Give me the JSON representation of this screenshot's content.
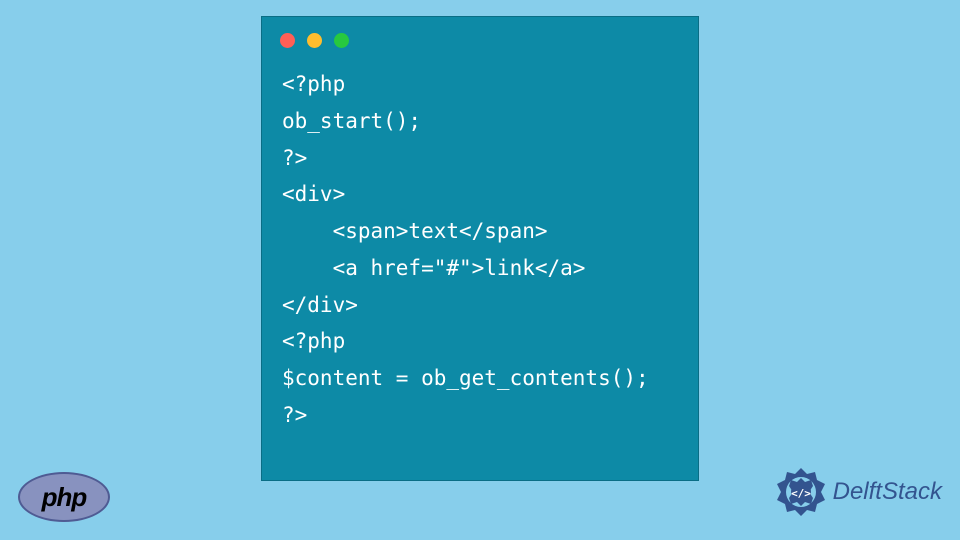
{
  "code": {
    "lines": [
      "<?php",
      "ob_start();",
      "?>",
      "<div>",
      "    <span>text</span>",
      "    <a href=\"#\">link</a>",
      "</div>",
      "<?php",
      "$content = ob_get_contents();",
      "?>"
    ]
  },
  "php_logo": {
    "text": "php"
  },
  "delft_logo": {
    "text": "DelftStack"
  }
}
